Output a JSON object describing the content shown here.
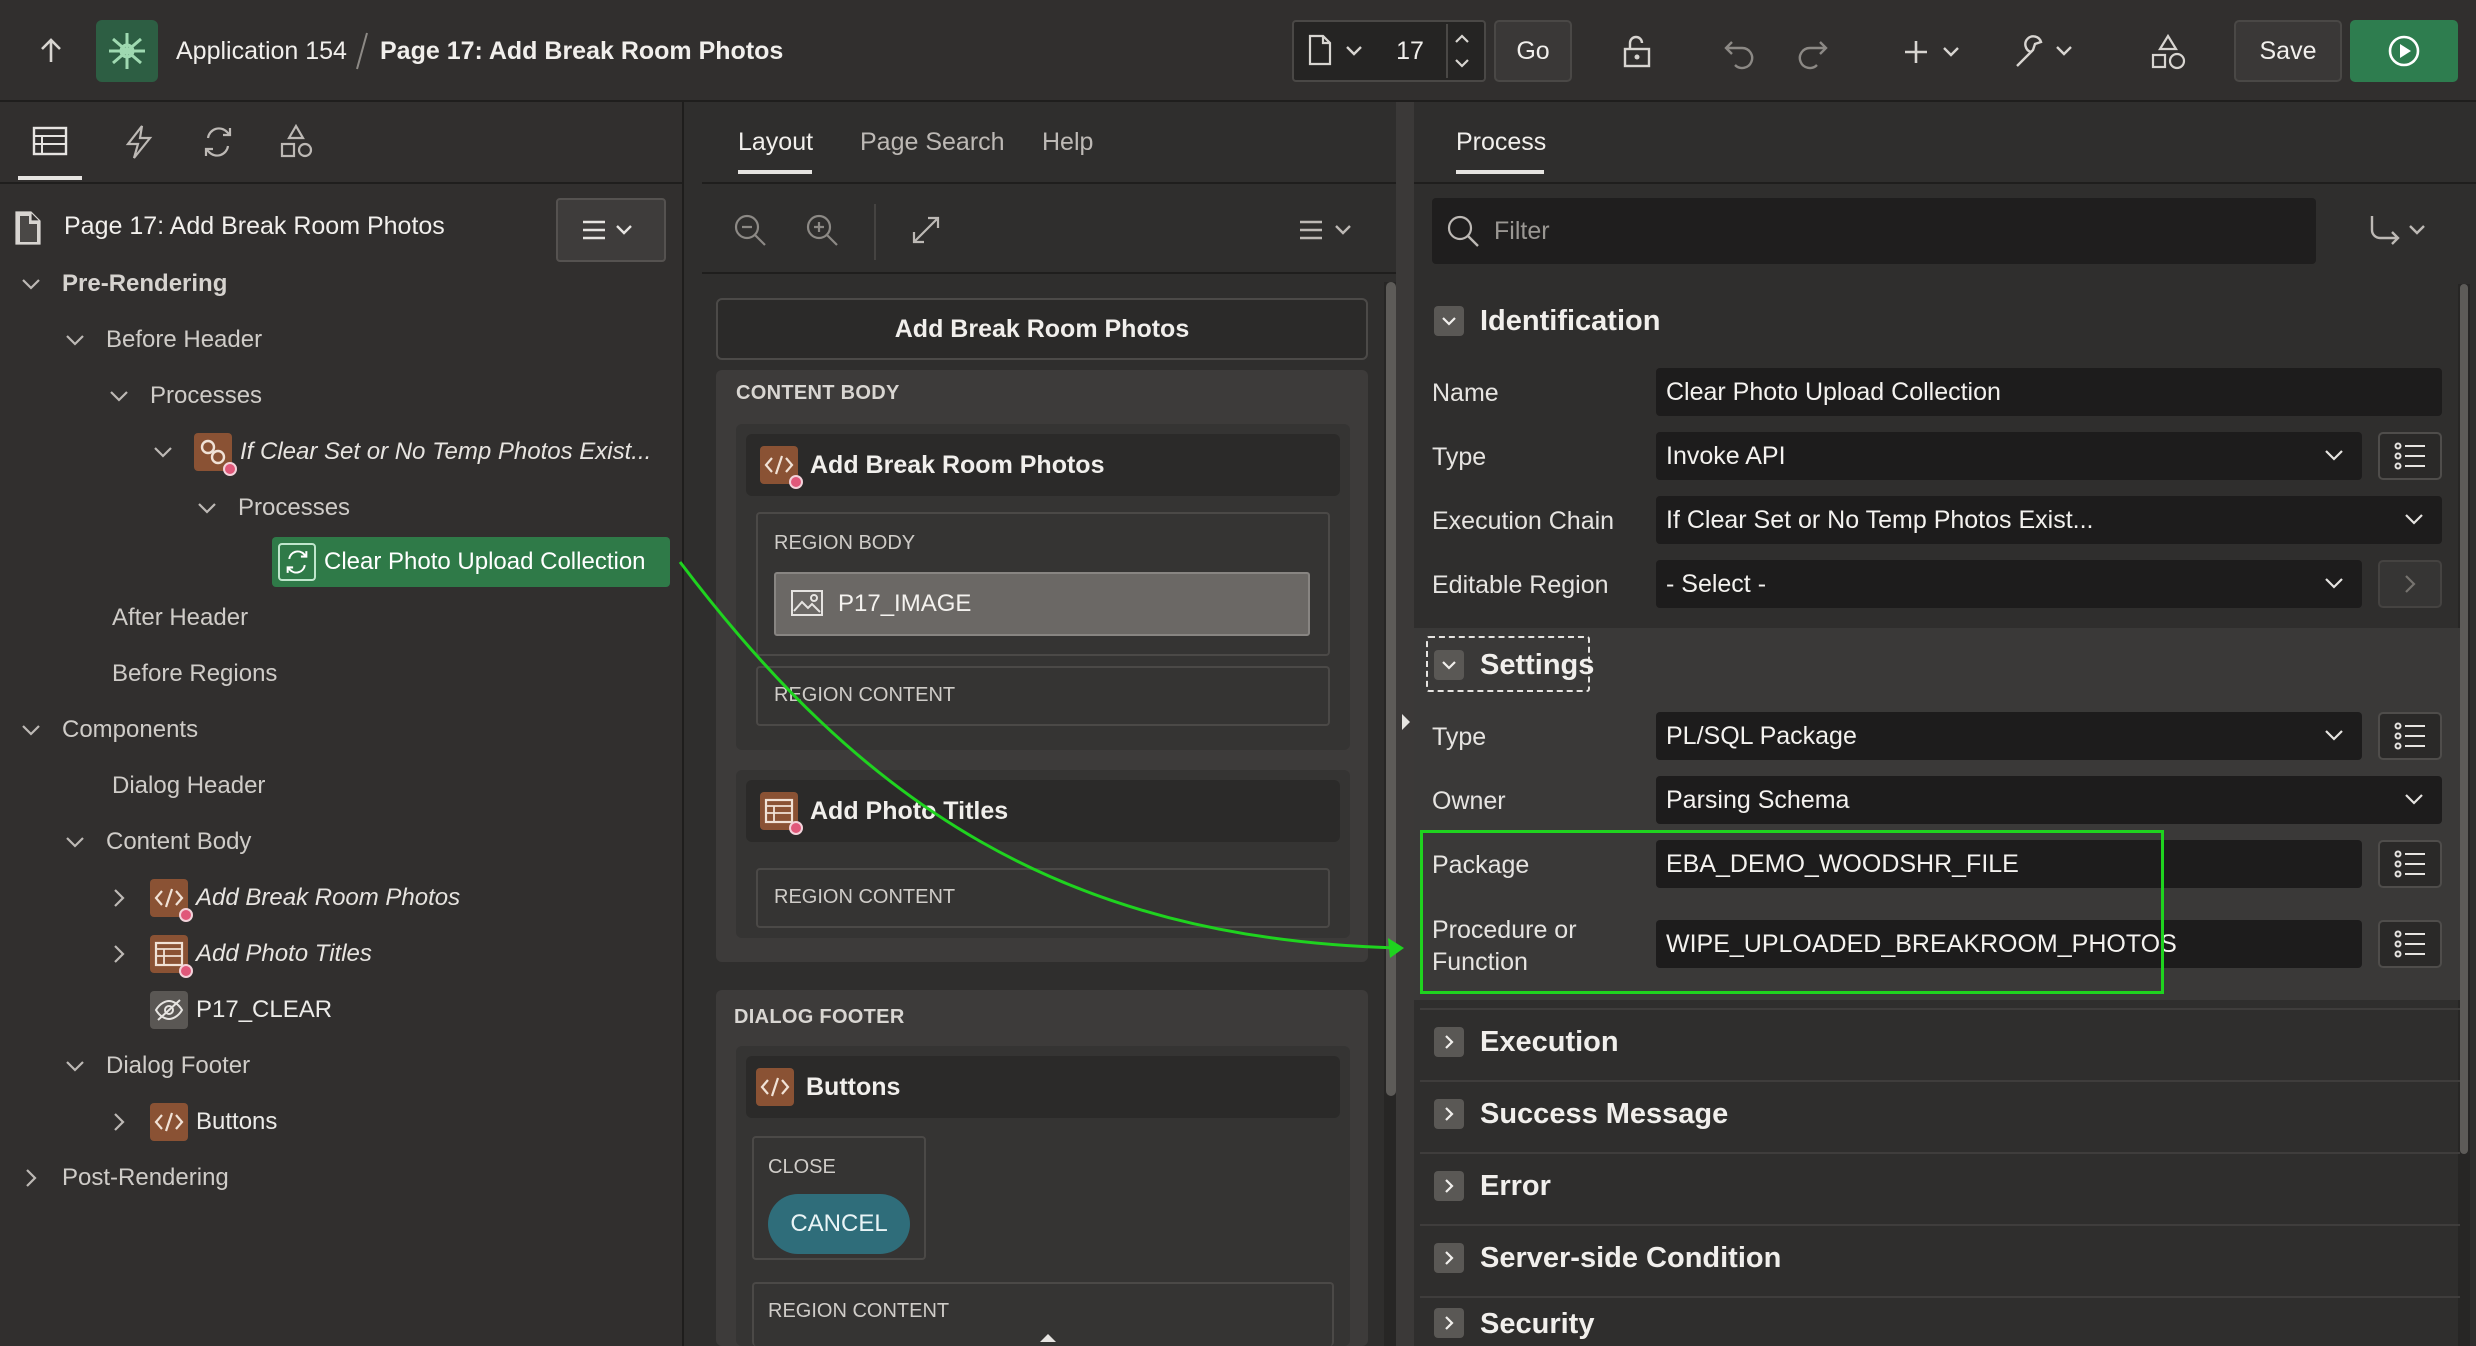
{
  "topbar": {
    "app_name": "Application 154",
    "page_title": "Page 17: Add Break Room Photos",
    "page_number": "17",
    "go_label": "Go",
    "save_label": "Save"
  },
  "left_panel": {
    "page_label": "Page 17: Add Break Room Photos",
    "tree": {
      "pre_rendering": "Pre-Rendering",
      "before_header": "Before Header",
      "processes": "Processes",
      "execution_chain": "If Clear Set or No Temp Photos Exist...",
      "sub_processes": "Processes",
      "selected_process": "Clear Photo Upload Collection",
      "after_header": "After Header",
      "before_regions": "Before Regions",
      "components": "Components",
      "dialog_header": "Dialog Header",
      "content_body": "Content Body",
      "region_1": "Add Break Room Photos",
      "region_2": "Add Photo Titles",
      "item_clear": "P17_CLEAR",
      "dialog_footer": "Dialog Footer",
      "buttons_region": "Buttons",
      "post_rendering": "Post-Rendering"
    }
  },
  "middle_panel": {
    "tabs": [
      "Layout",
      "Page Search",
      "Help"
    ],
    "page_header": "Add Break Room Photos",
    "content_body_caption": "CONTENT BODY",
    "region_1_title": "Add Break Room Photos",
    "region_body_caption": "REGION BODY",
    "image_item": "P17_IMAGE",
    "region_content_caption": "REGION CONTENT",
    "region_2_title": "Add Photo Titles",
    "dialog_footer_caption": "DIALOG FOOTER",
    "buttons_title": "Buttons",
    "close_caption": "CLOSE",
    "cancel_label": "CANCEL"
  },
  "right_panel": {
    "tab": "Process",
    "filter_placeholder": "Filter",
    "sections": {
      "identification": "Identification",
      "settings": "Settings",
      "execution": "Execution",
      "success_message": "Success Message",
      "error": "Error",
      "server_side_condition": "Server-side Condition",
      "security": "Security"
    },
    "identification": {
      "name_label": "Name",
      "name_value": "Clear Photo Upload Collection",
      "type_label": "Type",
      "type_value": "Invoke API",
      "chain_label": "Execution Chain",
      "chain_value": "If Clear Set or No Temp Photos Exist...",
      "editable_label": "Editable Region",
      "editable_value": "- Select -"
    },
    "settings": {
      "type_label": "Type",
      "type_value": "PL/SQL Package",
      "owner_label": "Owner",
      "owner_value": "Parsing Schema",
      "package_label": "Package",
      "package_value": "EBA_DEMO_WOODSHR_FILE",
      "procedure_label_1": "Procedure or",
      "procedure_label_2": "Function",
      "procedure_value": "WIPE_UPLOADED_BREAKROOM_PHOTOS"
    }
  },
  "colors": {
    "accent_green": "#2e7d4f",
    "selection_green": "#2f7a48",
    "annotation_green": "#1fd31f",
    "region_icon_brown": "#8a5234",
    "cancel_teal": "#2f6d7a"
  }
}
